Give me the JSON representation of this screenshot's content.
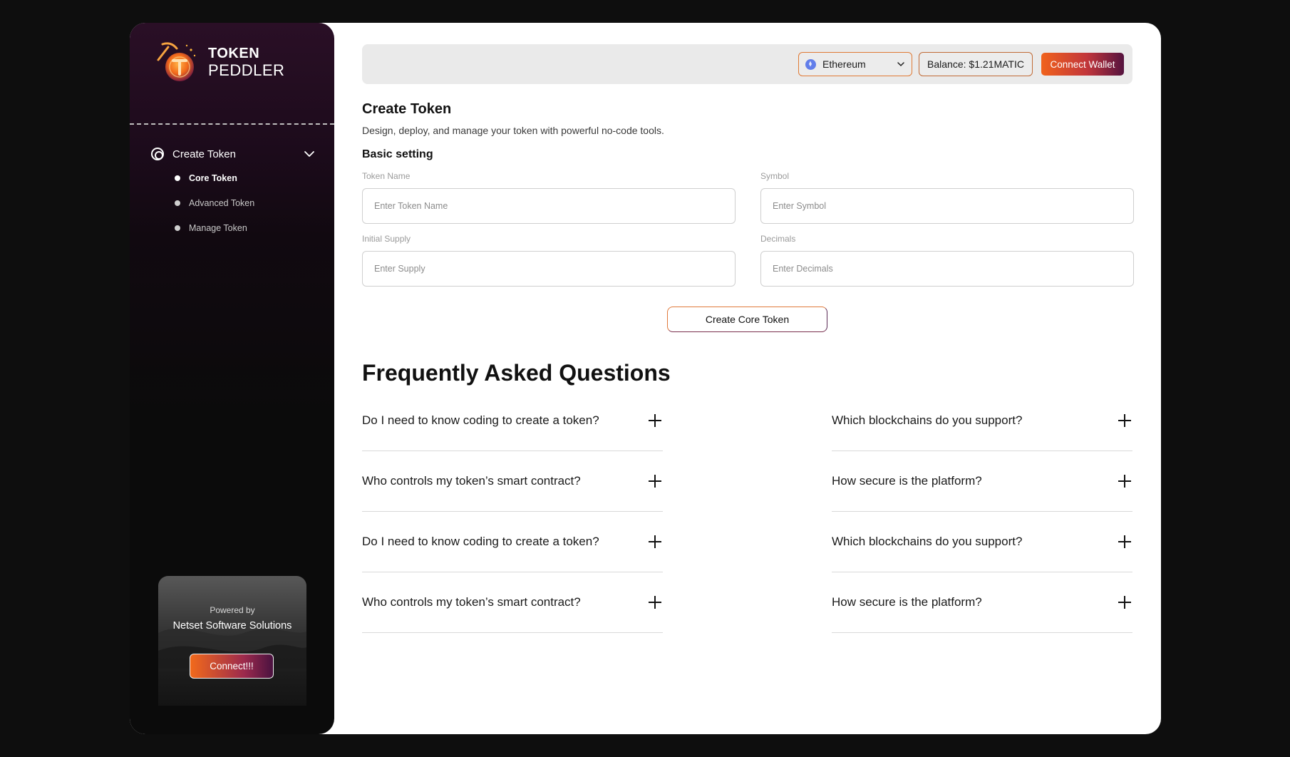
{
  "brand": {
    "line1": "TOKEN",
    "line2": "PEDDLER",
    "accent": "#f26a1b"
  },
  "sidebar": {
    "group_label": "Create Token",
    "items": [
      {
        "label": "Core Token",
        "active": true
      },
      {
        "label": "Advanced Token",
        "active": false
      },
      {
        "label": "Manage Token",
        "active": false
      }
    ],
    "promo": {
      "powered_by": "Powered by",
      "company": "Netset Software Solutions",
      "button": "Connect!!!"
    }
  },
  "topbar": {
    "chain": "Ethereum",
    "balance": "Balance: $1.21MATIC",
    "connect_wallet": "Connect Wallet"
  },
  "main": {
    "title": "Create Token",
    "subtitle": "Design, deploy, and manage your token with powerful no-code tools.",
    "section": "Basic setting",
    "fields": {
      "token_name": {
        "label": "Token Name",
        "placeholder": "Enter Token Name"
      },
      "symbol": {
        "label": "Symbol",
        "placeholder": "Enter Symbol"
      },
      "supply": {
        "label": "Initial Supply",
        "placeholder": "Enter Supply"
      },
      "decimals": {
        "label": "Decimals",
        "placeholder": "Enter Decimals"
      }
    },
    "submit": "Create Core Token"
  },
  "faq": {
    "title": "Frequently Asked Questions",
    "left": [
      "Do I need to know coding to create a token?",
      "Who controls my token’s smart contract?",
      "Do I need to know coding to create a token?",
      "Who controls my token’s smart contract?"
    ],
    "right": [
      "Which blockchains do you support?",
      "How secure is the platform?",
      "Which blockchains do you support?",
      "How secure is the platform?"
    ]
  }
}
